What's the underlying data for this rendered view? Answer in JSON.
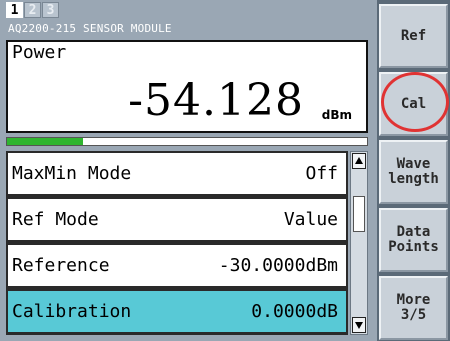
{
  "tabs": [
    {
      "label": "1",
      "active": true
    },
    {
      "label": "2",
      "active": false
    },
    {
      "label": "3",
      "active": false
    }
  ],
  "module_title": "AQ2200-215 SENSOR MODULE",
  "measurement": {
    "label": "Power",
    "value": "-54.128",
    "unit": "dBm",
    "level_fraction": 0.21
  },
  "settings": [
    {
      "label": "MaxMin Mode",
      "value": "Off",
      "selected": false
    },
    {
      "label": "Ref Mode",
      "value": "Value",
      "selected": false
    },
    {
      "label": "Reference",
      "value": "-30.0000dBm",
      "selected": false
    },
    {
      "label": "Calibration",
      "value": "0.0000dB",
      "selected": true
    }
  ],
  "softkeys": [
    {
      "label": "Ref"
    },
    {
      "label": "Cal"
    },
    {
      "label": "Wave\nlength"
    },
    {
      "label": "Data\nPoints"
    },
    {
      "label": "More\n3/5"
    }
  ],
  "colors": {
    "selected_row": "#58c9d6",
    "level_bar": "#2fb52f",
    "highlight_ring": "#e03333"
  },
  "icons": {
    "scroll_up": "triangle-up-icon",
    "scroll_down": "triangle-down-icon"
  }
}
